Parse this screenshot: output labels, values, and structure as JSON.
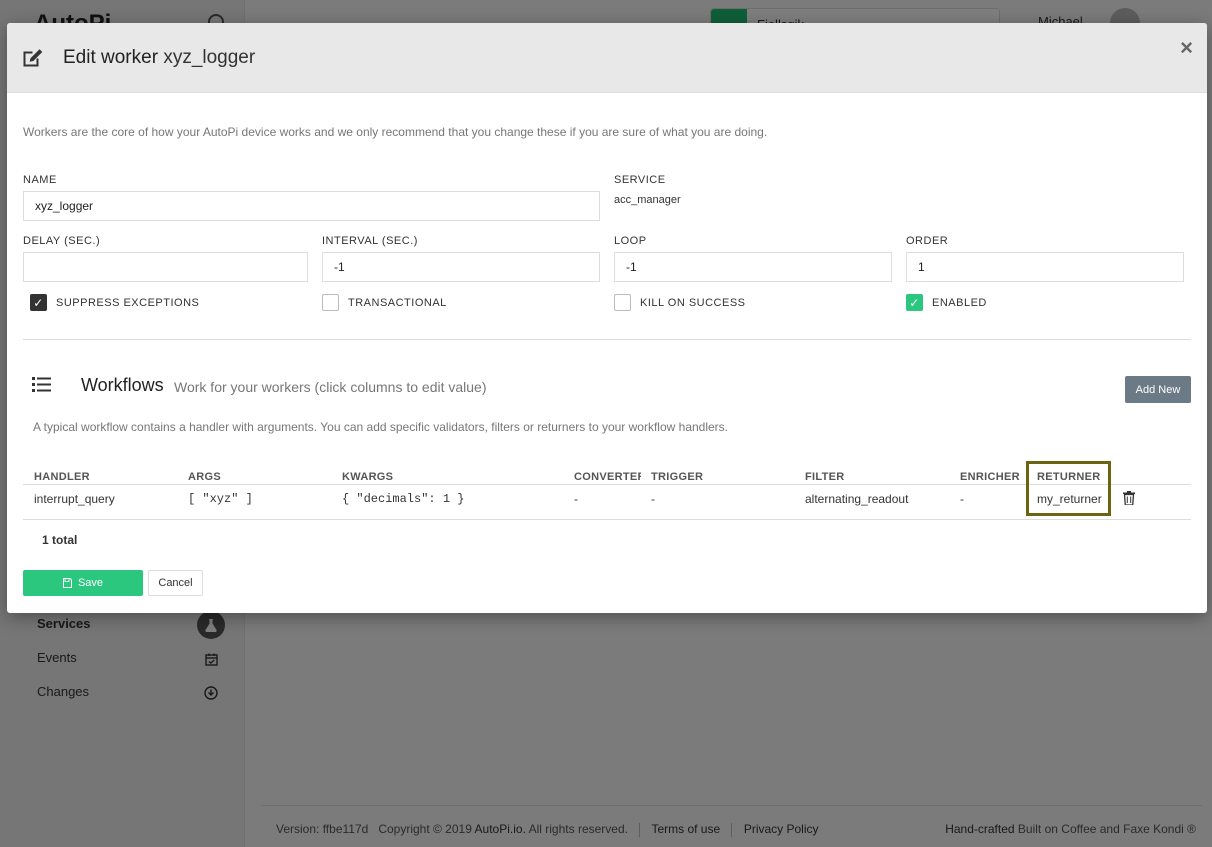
{
  "app": {
    "logo": "AutoPi",
    "device_name": "Fjellsgik",
    "user_name": "Michael",
    "sidebar": [
      {
        "label": "Services",
        "icon": "flask-icon",
        "active": true
      },
      {
        "label": "Events",
        "icon": "calendar-check-icon",
        "active": false
      },
      {
        "label": "Changes",
        "icon": "download-circle-icon",
        "active": false
      }
    ],
    "footer": {
      "version": "Version: ffbe117d",
      "copyright_prefix": "Copyright © 2019",
      "brand": "AutoPi.io.",
      "rights": "All rights reserved.",
      "terms": "Terms of use",
      "privacy": "Privacy Policy",
      "handcrafted": "Hand-crafted",
      "built_on": "Built on Coffee and Faxe Kondi ®"
    }
  },
  "modal": {
    "title_prefix": "Edit worker",
    "title_name": "xyz_logger",
    "close": "×",
    "intro": "Workers are the core of how your AutoPi device works and we only recommend that you change these if you are sure of what you are doing.",
    "fields": {
      "name_label": "NAME",
      "name_value": "xyz_logger",
      "service_label": "SERVICE",
      "service_value": "acc_manager",
      "delay_label": "DELAY (SEC.)",
      "delay_value": "",
      "interval_label": "INTERVAL (SEC.)",
      "interval_value": "-1",
      "loop_label": "LOOP",
      "loop_value": "-1",
      "order_label": "ORDER",
      "order_value": "1"
    },
    "checkboxes": [
      {
        "label": "SUPPRESS EXCEPTIONS",
        "checked": true
      },
      {
        "label": "TRANSACTIONAL",
        "checked": false
      },
      {
        "label": "KILL ON SUCCESS",
        "checked": false
      },
      {
        "label": "ENABLED",
        "checked": true
      }
    ],
    "workflows": {
      "title": "Workflows",
      "subtitle": "Work for your workers (click columns to edit value)",
      "add_new": "Add New",
      "description": "A typical workflow contains a handler with arguments. You can add specific validators, filters or returners to your workflow handlers.",
      "columns": [
        "HANDLER",
        "ARGS",
        "KWARGS",
        "CONVERTER",
        "TRIGGER",
        "FILTER",
        "ENRICHER",
        "RETURNER"
      ],
      "rows": [
        [
          "interrupt_query",
          "[ \"xyz\" ]",
          "{ \"decimals\": 1 }",
          "-",
          "-",
          "alternating_readout",
          "-",
          "my_returner"
        ]
      ],
      "total": "1 total"
    },
    "save": "Save",
    "cancel": "Cancel"
  }
}
